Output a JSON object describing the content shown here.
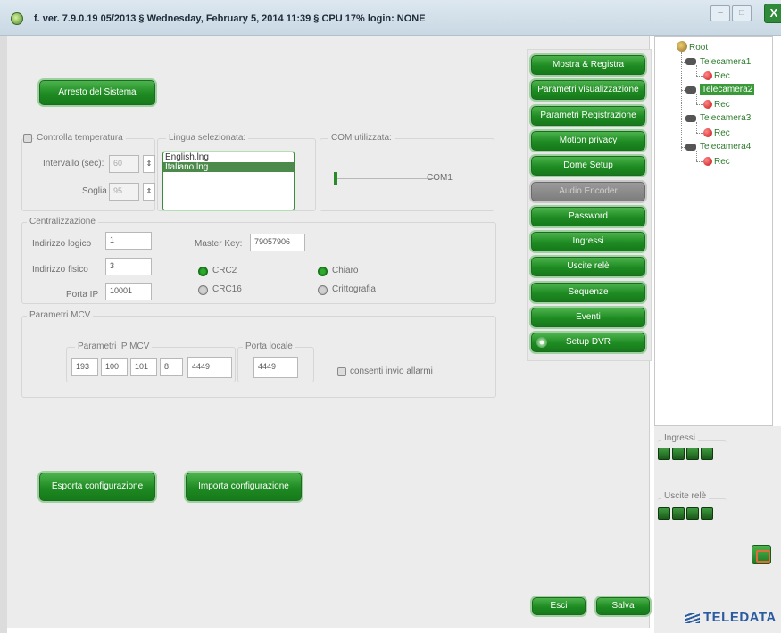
{
  "titlebar": {
    "title": "f. ver. 7.9.0.19  05/2013   §  Wednesday, February 5, 2014  11:39   §  CPU 17%   login: NONE",
    "min_glyph": "–",
    "max_glyph": "□",
    "close_glyph": "X"
  },
  "buttons": {
    "stop_system": "Arresto del Sistema",
    "export_config": "Esporta configurazione",
    "import_config": "Importa configurazione",
    "exit": "Esci",
    "save": "Salva"
  },
  "temperature": {
    "checkbox_label": "Controlla temperatura",
    "interval_label": "Intervallo (sec):",
    "interval_value": "60",
    "threshold_label": "Soglia",
    "threshold_value": "95",
    "spin_glyph": "⇕"
  },
  "language": {
    "label": "Lingua selezionata:",
    "options": [
      "English.lng",
      "Italiano.lng"
    ],
    "selected": "Italiano.lng"
  },
  "com": {
    "label": "COM utilizzata:",
    "value": "COM1"
  },
  "centralization": {
    "group_label": "Centralizzazione",
    "logical_address_label": "Indirizzo logico",
    "logical_address": "1",
    "physical_address_label": "Indirizzo fisico",
    "physical_address": "3",
    "ip_port_label": "Porta IP",
    "ip_port": "10001",
    "master_key_label": "Master Key:",
    "master_key": "79057906",
    "crc2": "CRC2",
    "crc16": "CRC16",
    "clear": "Chiaro",
    "crypto": "Crittografia",
    "crc_selected": "CRC2",
    "mode_selected": "Chiaro"
  },
  "mcv": {
    "group_label": "Parametri MCV",
    "ip_group_label": "Parametri IP MCV",
    "ip_octets": [
      "193",
      "100",
      "101",
      "8"
    ],
    "ip_port": "4449",
    "local_port_label": "Porta locale",
    "local_port": "4449",
    "allow_alarms_label": "consenti invio allarmi"
  },
  "menu": [
    {
      "label": "Mostra & Registra",
      "enabled": true
    },
    {
      "label": "Parametri visualizzazione",
      "enabled": true
    },
    {
      "label": "Parametri Registrazione",
      "enabled": true
    },
    {
      "label": "Motion privacy",
      "enabled": true
    },
    {
      "label": "Dome Setup",
      "enabled": true
    },
    {
      "label": "Audio Encoder",
      "enabled": false
    },
    {
      "label": "Password",
      "enabled": true
    },
    {
      "label": "Ingressi",
      "enabled": true
    },
    {
      "label": "Uscite relè",
      "enabled": true
    },
    {
      "label": "Sequenze",
      "enabled": true
    },
    {
      "label": "Eventi",
      "enabled": true
    },
    {
      "label": "Setup DVR",
      "enabled": true
    }
  ],
  "tree": {
    "root": "Root",
    "cameras": [
      {
        "name": "Telecamera1",
        "rec": "Rec"
      },
      {
        "name": "Telecamera2",
        "rec": "Rec"
      },
      {
        "name": "Telecamera3",
        "rec": "Rec"
      },
      {
        "name": "Telecamera4",
        "rec": "Rec"
      }
    ],
    "selected": "Telecamera2"
  },
  "io": {
    "inputs_label": "Ingressi",
    "outputs_label": "Uscite relè"
  },
  "brand": {
    "logo": "TELEDATA",
    "accent": "#1e8a22",
    "logo_color": "#2a5aa0"
  }
}
